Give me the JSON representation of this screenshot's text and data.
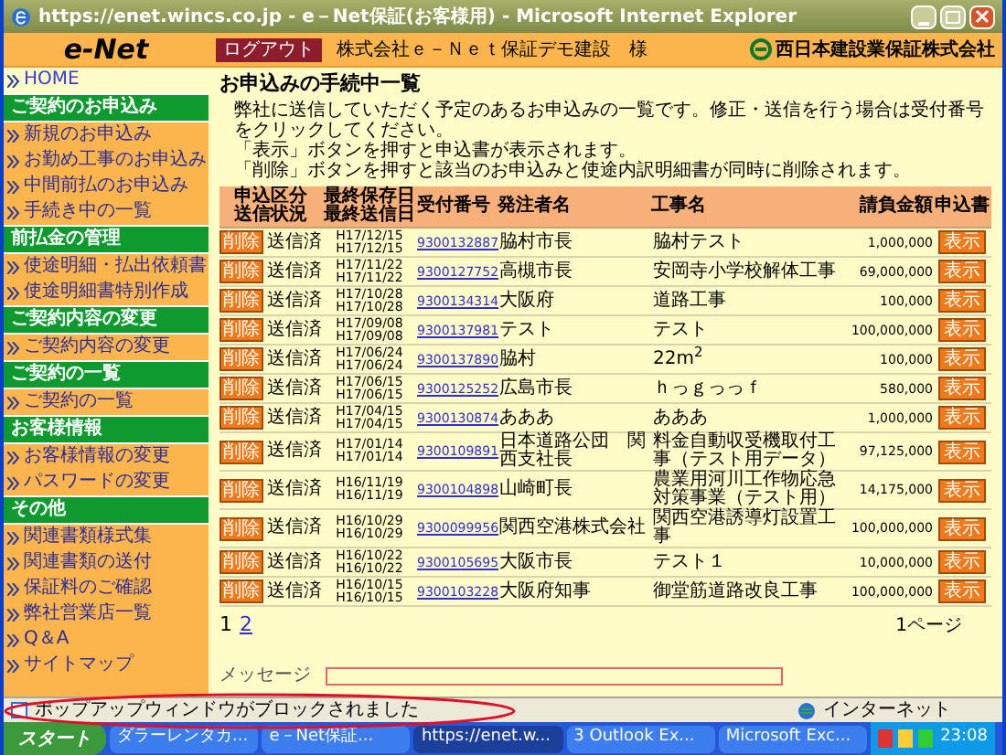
{
  "window": {
    "title": "https://enet.wincs.co.jp - e－Net保証(お客様用) - Microsoft Internet Explorer"
  },
  "header": {
    "logo": "e-Net",
    "logout": "ログアウト",
    "customer": "株式会社ｅ－Ｎｅｔ保証デモ建設　様",
    "company": "西日本建設業保証株式会社"
  },
  "sidebar": {
    "home": "HOME",
    "sections": [
      {
        "title": "ご契約のお申込み",
        "items": [
          "新規のお申込み",
          "お勤め工事のお申込み",
          "中間前払のお申込み",
          "手続き中の一覧"
        ]
      },
      {
        "title": "前払金の管理",
        "items": [
          "使途明細・払出依頼書",
          "使途明細書特別作成"
        ]
      },
      {
        "title": "ご契約内容の変更",
        "items": [
          "ご契約内容の変更"
        ]
      },
      {
        "title": "ご契約の一覧",
        "items": [
          "ご契約の一覧"
        ]
      },
      {
        "title": "お客様情報",
        "items": [
          "お客様情報の変更",
          "パスワードの変更"
        ]
      },
      {
        "title": "その他",
        "items": [
          "関連書類様式集",
          "関連書類の送付",
          "保証料のご確認",
          "弊社営業店一覧",
          "Q＆A",
          "サイトマップ"
        ]
      }
    ]
  },
  "page_title": "お申込みの手続中一覧",
  "description": [
    "弊社に送信していただく予定のあるお申込みの一覧です。修正・送信を行う場合は受付番号をクリックしてください。",
    "「表示」ボタンを押すと申込書が表示されます。",
    "「削除」ボタンを押すと該当のお申込みと使途内訳明細書が同時に削除されます。"
  ],
  "table": {
    "columns": [
      [
        "申込区分",
        "送信状況"
      ],
      [
        "最終保存日",
        "最終送信日"
      ],
      [
        "受付番号"
      ],
      [
        "発注者名"
      ],
      [
        "工事名"
      ],
      [
        "請負金額"
      ],
      [
        "申込書"
      ]
    ],
    "rows": [
      {
        "delete": "削除",
        "status": "送信済",
        "saved": "H17/12/15",
        "sent": "H17/12/15",
        "number": "9300132887",
        "orderer": "脇村市長",
        "work": "脇村テスト",
        "amount": "1,000,000",
        "view": "表示"
      },
      {
        "delete": "削除",
        "status": "送信済",
        "saved": "H17/11/22",
        "sent": "H17/11/22",
        "number": "9300127752",
        "orderer": "高槻市長",
        "work": "安岡寺小学校解体工事",
        "amount": "69,000,000",
        "view": "表示"
      },
      {
        "delete": "削除",
        "status": "送信済",
        "saved": "H17/10/28",
        "sent": "H17/10/28",
        "number": "9300134314",
        "orderer": "大阪府",
        "work": "道路工事",
        "amount": "100,000",
        "view": "表示"
      },
      {
        "delete": "削除",
        "status": "送信済",
        "saved": "H17/09/08",
        "sent": "H17/09/08",
        "number": "9300137981",
        "orderer": "テスト",
        "work": "テスト",
        "amount": "100,000,000",
        "view": "表示"
      },
      {
        "delete": "削除",
        "status": "送信済",
        "saved": "H17/06/24",
        "sent": "H17/06/24",
        "number": "9300137890",
        "orderer": "脇村",
        "work": "22m$^{2}$",
        "amount": "100,000",
        "view": "表示"
      },
      {
        "delete": "削除",
        "status": "送信済",
        "saved": "H17/06/15",
        "sent": "H17/06/15",
        "number": "9300125252",
        "orderer": "広島市長",
        "work": "ｈっｇっっｆ",
        "amount": "580,000",
        "view": "表示"
      },
      {
        "delete": "削除",
        "status": "送信済",
        "saved": "H17/04/15",
        "sent": "H17/04/15",
        "number": "9300130874",
        "orderer": "あああ",
        "work": "あああ",
        "amount": "1,000,000",
        "view": "表示"
      },
      {
        "delete": "削除",
        "status": "送信済",
        "saved": "H17/01/14",
        "sent": "H17/01/14",
        "number": "9300109891",
        "orderer": "日本道路公団　関西支社長",
        "work": "料金自動収受機取付工事（テスト用データ）",
        "amount": "97,125,000",
        "view": "表示"
      },
      {
        "delete": "削除",
        "status": "送信済",
        "saved": "H16/11/19",
        "sent": "H16/11/19",
        "number": "9300104898",
        "orderer": "山崎町長",
        "work": "農業用河川工作物応急対策事業（テスト用）",
        "amount": "14,175,000",
        "view": "表示"
      },
      {
        "delete": "削除",
        "status": "送信済",
        "saved": "H16/10/29",
        "sent": "H16/10/29",
        "number": "9300099956",
        "orderer": "関西空港株式会社",
        "work": "関西空港誘導灯設置工事",
        "amount": "100,000,000",
        "view": "表示"
      },
      {
        "delete": "削除",
        "status": "送信済",
        "saved": "H16/10/22",
        "sent": "H16/10/22",
        "number": "9300105695",
        "orderer": "大阪市長",
        "work": "テスト１",
        "amount": "10,000,000",
        "view": "表示"
      },
      {
        "delete": "削除",
        "status": "送信済",
        "saved": "H16/10/15",
        "sent": "H16/10/15",
        "number": "9300103228",
        "orderer": "大阪府知事",
        "work": "御堂筋道路改良工事",
        "amount": "100,000,000",
        "view": "表示"
      }
    ]
  },
  "pagination": {
    "pages": [
      {
        "label": "1",
        "selected": true
      },
      {
        "label": "2",
        "selected": false
      }
    ],
    "page_label": "1ページ"
  },
  "message": {
    "label": "メッセージ"
  },
  "status_bar": {
    "text": "ポップアップウィンドウがブロックされました",
    "zone": "インターネット"
  },
  "taskbar": {
    "start": "スタート",
    "tasks": [
      {
        "label": "ダラーレンタカ...",
        "selected": false
      },
      {
        "label": "e－Net保証...",
        "selected": false
      },
      {
        "label": "https://enet.w...",
        "selected": true
      },
      {
        "label": "3 Outlook Ex...",
        "selected": false
      },
      {
        "label": "Microsoft Exc...",
        "selected": false
      }
    ],
    "clock": "23:08"
  }
}
